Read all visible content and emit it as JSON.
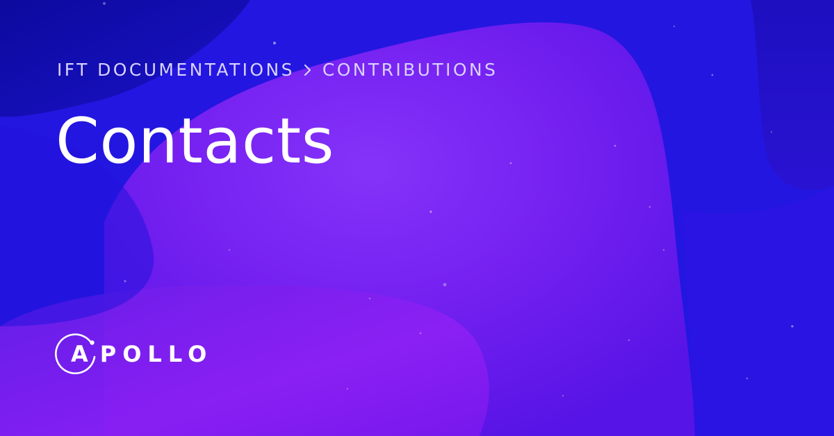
{
  "breadcrumb": {
    "parent": "IFT DOCUMENTATIONS",
    "current": "CONTRIBUTIONS"
  },
  "page": {
    "title": "Contacts"
  },
  "logo": {
    "first_letter": "A",
    "rest": "POLLO"
  },
  "colors": {
    "background_blue": "#2a17e6",
    "accent_purple": "#8a2bf5",
    "breadcrumb_text": "#d9d2ff",
    "title_text": "#ffffff"
  },
  "icons": {
    "breadcrumb_separator": "chevron-right-icon",
    "logo_mark": "apollo-ring-icon"
  }
}
